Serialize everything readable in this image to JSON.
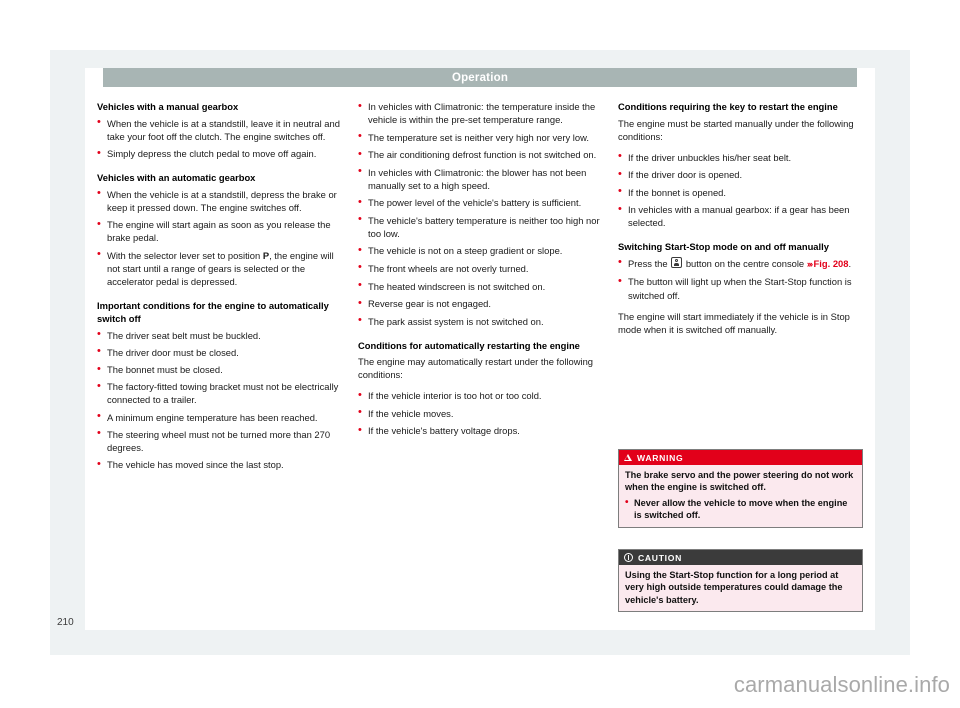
{
  "header": {
    "title": "Operation"
  },
  "folio": "210",
  "watermark": "carmanualsonline.info",
  "columns": {
    "left": {
      "heading_manual": "Vehicles with a manual gearbox",
      "manual_items": [
        "When the vehicle is at a standstill, leave it in neutral and take your foot off the clutch. The engine switches off.",
        "Simply depress the clutch pedal to move off again."
      ],
      "heading_automatic": "Vehicles with an automatic gearbox",
      "automatic_item_1": "When the vehicle is at a standstill, depress the brake or keep it pressed down. The engine switches off.",
      "automatic_item_2": "The engine will start again as soon as you release the brake pedal.",
      "automatic_item_3_pre": "With the selector lever set to position ",
      "automatic_item_3_bold": "P",
      "automatic_item_3_post": ", the engine will not start until a range of gears is selected or the accelerator pedal is depressed.",
      "heading_conditions_off": "Important conditions for the engine to automatically switch off",
      "conditions_off_items": [
        "The driver seat belt must be buckled.",
        "The driver door must be closed.",
        "The bonnet must be closed.",
        "The factory-fitted towing bracket must not be electrically connected to a trailer.",
        "A minimum engine temperature has been reached.",
        "The steering wheel must not be turned more than 270 degrees.",
        "The vehicle has moved since the last stop."
      ]
    },
    "middle": {
      "continued_items": [
        "In vehicles with Climatronic: the temperature inside the vehicle is within the pre-set temperature range.",
        "The temperature set is neither very high nor very low.",
        "The air conditioning defrost function is not switched on.",
        "In vehicles with Climatronic: the blower has not been manually set to a high speed.",
        "The power level of the vehicle's battery is sufficient.",
        "The vehicle's battery temperature is neither too high nor too low.",
        "The vehicle is not on a steep gradient or slope.",
        "The front wheels are not overly turned.",
        "The heated windscreen is not switched on.",
        "Reverse gear is not engaged.",
        "The park assist system is not switched on."
      ],
      "heading_restart": "Conditions for automatically restarting the engine",
      "restart_intro": "The engine may automatically restart under the following conditions:",
      "restart_items": [
        "If the vehicle interior is too hot or too cold.",
        "If the vehicle moves.",
        "If the vehicle's battery voltage drops."
      ]
    },
    "right": {
      "heading_key_restart": "Conditions requiring the key to restart the engine",
      "key_restart_intro": "The engine must be started manually under the following conditions:",
      "key_restart_items": [
        "If the driver unbuckles his/her seat belt.",
        "If the driver door is opened.",
        "If the bonnet is opened.",
        "In vehicles with a manual gearbox: if a gear has been selected."
      ],
      "heading_switching": "Switching Start-Stop mode on and off manually",
      "switching_item_1_pre": "Press the ",
      "switching_item_1_post": " button on the centre console ",
      "switching_item_1_xref_arrows": "›››",
      "switching_item_1_xref_label": "Fig. 208",
      "switching_item_1_end": ".",
      "switching_item_2": "The button will light up when the Start-Stop function is switched off.",
      "switching_paragraph": "The engine will start immediately if the vehicle is in Stop mode when it is switched off manually."
    }
  },
  "warning": {
    "label": "WARNING",
    "body_paragraph": "The brake servo and the power steering do not work when the engine is switched off.",
    "bullet": "Never allow the vehicle to move when the engine is switched off."
  },
  "caution": {
    "label": "CAUTION",
    "body_paragraph": "Using the Start-Stop function for a long period at very high outside temperatures could damage the vehicle's battery."
  },
  "colors": {
    "accent_red": "#e2001a",
    "header_bar": "#a8b5b4",
    "page_sheet": "#eef2f3",
    "caution_bar": "#3b3b3b",
    "notice_body": "#fbe9ee"
  }
}
